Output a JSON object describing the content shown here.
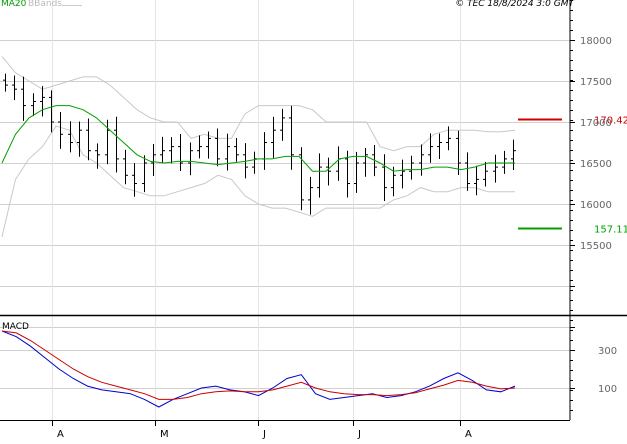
{
  "header": {
    "legend_ma": "MA20",
    "legend_bands": "BBands",
    "copyright": "© TEC 18/8/2024 3:0 GMT"
  },
  "macd_label": "MACD",
  "chart_data": [
    {
      "type": "ohlc",
      "panel": "price",
      "title": "",
      "ylim": [
        15000,
        18300
      ],
      "y_ticks": [
        "18000",
        "17500",
        "17000",
        "16500",
        "16000",
        "15500"
      ],
      "x_ticks": [
        "A",
        "M",
        "J",
        "J",
        "A"
      ],
      "grid": true,
      "series": [
        {
          "name": "MA20",
          "color": "#00a000",
          "values": [
            16500,
            16850,
            17050,
            17150,
            17200,
            17200,
            17150,
            17050,
            16900,
            16750,
            16600,
            16520,
            16500,
            16520,
            16520,
            16500,
            16480,
            16500,
            16520,
            16550,
            16550,
            16580,
            16580,
            16400,
            16400,
            16550,
            16580,
            16580,
            16500,
            16400,
            16420,
            16420,
            16450,
            16450,
            16420,
            16450,
            16500,
            16500,
            16500
          ]
        },
        {
          "name": "BBands upper",
          "color": "#c8c8c8",
          "values": [
            17800,
            17600,
            17500,
            17400,
            17450,
            17500,
            17550,
            17550,
            17450,
            17300,
            17150,
            17050,
            17000,
            17000,
            16800,
            16850,
            16800,
            16800,
            17100,
            17200,
            17200,
            17200,
            17200,
            17150,
            17000,
            17000,
            17000,
            17000,
            16700,
            16650,
            16700,
            16700,
            16850,
            16900,
            16900,
            16900,
            16880,
            16880,
            16900
          ]
        },
        {
          "name": "BBands lower",
          "color": "#c8c8c8",
          "values": [
            15600,
            16300,
            16550,
            16700,
            16950,
            16900,
            16600,
            16500,
            16350,
            16200,
            16150,
            16100,
            16100,
            16150,
            16200,
            16250,
            16350,
            16300,
            16100,
            16000,
            15950,
            15950,
            15900,
            15850,
            15950,
            15950,
            15950,
            15950,
            15950,
            16050,
            16100,
            16200,
            16150,
            16150,
            16200,
            16200,
            16150,
            16150,
            16150
          ]
        }
      ],
      "ohlc_close": [
        17450,
        17400,
        17200,
        17250,
        17300,
        17000,
        16850,
        16750,
        16900,
        16650,
        16600,
        16900,
        16550,
        16350,
        16250,
        16500,
        16600,
        16650,
        16700,
        16500,
        16650,
        16700,
        16800,
        16550,
        16700,
        16600,
        16450,
        16550,
        16750,
        16900,
        17050,
        16600,
        16050,
        16200,
        16450,
        16400,
        16550,
        16250,
        16500,
        16600,
        16450,
        16200,
        16350,
        16400,
        16500,
        16600,
        16700,
        16750,
        16800,
        16500,
        16250,
        16300,
        16400,
        16450,
        16550,
        16650
      ],
      "reference_levels": [
        {
          "label": "170.42",
          "value": 17042,
          "color": "#cc0000"
        },
        {
          "label": "157.11",
          "value": 15711,
          "color": "#00a000"
        }
      ]
    },
    {
      "type": "line",
      "panel": "macd",
      "ylim": [
        -50,
        400
      ],
      "y_ticks": [
        "300",
        "100"
      ],
      "grid": true,
      "series": [
        {
          "name": "MACD",
          "color": "#0000cc",
          "values": [
            400,
            370,
            320,
            260,
            200,
            150,
            110,
            90,
            80,
            70,
            40,
            0,
            40,
            70,
            100,
            110,
            90,
            80,
            60,
            100,
            150,
            170,
            70,
            40,
            50,
            60,
            70,
            50,
            60,
            80,
            110,
            150,
            180,
            140,
            90,
            80,
            110
          ]
        },
        {
          "name": "Signal",
          "color": "#cc0000",
          "values": [
            400,
            390,
            350,
            300,
            250,
            200,
            160,
            130,
            110,
            90,
            70,
            40,
            40,
            50,
            70,
            80,
            85,
            80,
            80,
            90,
            110,
            130,
            100,
            80,
            70,
            65,
            65,
            60,
            65,
            75,
            95,
            115,
            140,
            130,
            110,
            95,
            100
          ]
        }
      ]
    }
  ]
}
